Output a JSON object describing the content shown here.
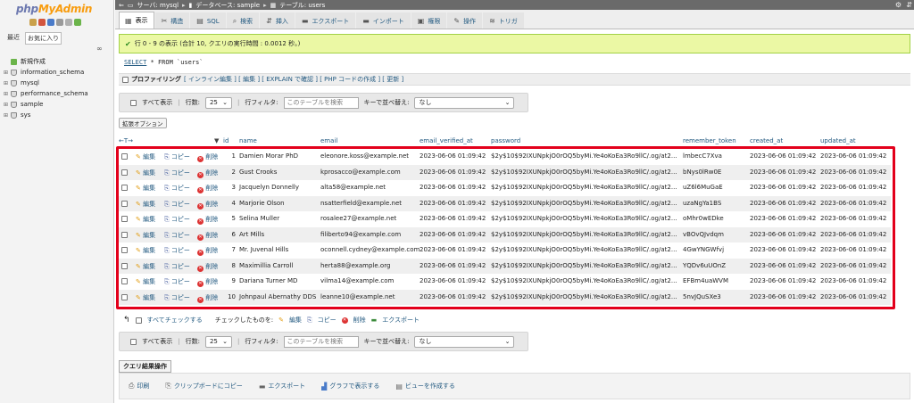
{
  "sidebar": {
    "logo_php": "php",
    "logo_myadmin": "MyAdmin",
    "tabs": [
      "最近",
      "お気に入り"
    ],
    "new_label": "新規作成",
    "databases": [
      "information_schema",
      "mysql",
      "performance_schema",
      "sample",
      "sys"
    ]
  },
  "breadcrumb": {
    "server": "サーバ: mysql",
    "database": "データベース: sample",
    "table": "テーブル: users"
  },
  "tabs": [
    {
      "label": "表示",
      "icon": "browse-icon",
      "glyph": "▦",
      "active": true
    },
    {
      "label": "構造",
      "icon": "structure-icon",
      "glyph": "✂",
      "active": false
    },
    {
      "label": "SQL",
      "icon": "sql-icon",
      "glyph": "▤",
      "active": false
    },
    {
      "label": "検索",
      "icon": "search-icon",
      "glyph": "⌕",
      "active": false
    },
    {
      "label": "挿入",
      "icon": "insert-icon",
      "glyph": "⇵",
      "active": false
    },
    {
      "label": "エクスポート",
      "icon": "export-icon",
      "glyph": "▬",
      "active": false
    },
    {
      "label": "インポート",
      "icon": "import-icon",
      "glyph": "▬",
      "active": false
    },
    {
      "label": "権限",
      "icon": "privileges-icon",
      "glyph": "▣",
      "active": false
    },
    {
      "label": "操作",
      "icon": "operations-icon",
      "glyph": "✎",
      "active": false
    },
    {
      "label": "トリガ",
      "icon": "triggers-icon",
      "glyph": "≋",
      "active": false
    }
  ],
  "message": "行 0 - 9 の表示 (合計 10, クエリの実行時間 : 0.0012 秒。)",
  "sql": {
    "keyword": "SELECT",
    "rest": " * FROM `users`"
  },
  "profiling": {
    "label": "プロファイリング",
    "links": "[ インライン編集 ] [ 編集 ] [ EXPLAIN で確認 ] [ PHP コードの作成 ] [ 更新 ]"
  },
  "nav": {
    "show_all": "すべて表示",
    "rows_label": "行数:",
    "rows_value": "25",
    "filter_label": "行フィルタ:",
    "filter_placeholder": "このテーブルを検索",
    "sort_label": "キーで並べ替え:",
    "sort_value": "なし"
  },
  "extra_options": "拡張オプション",
  "columns": [
    "id",
    "name",
    "email",
    "email_verified_at",
    "password",
    "remember_token",
    "created_at",
    "updated_at"
  ],
  "header_arrows": "←T→",
  "sort_arrow": "▼",
  "actions": {
    "edit": "編集",
    "copy": "コピー",
    "delete": "削除"
  },
  "rows": [
    {
      "id": "1",
      "name": "Damien Morar PhD",
      "email": "eleonore.koss@example.net",
      "verified": "2023-06-06 01:09:42",
      "password": "$2y$10$92IXUNpkjO0rOQ5byMi.Ye4oKoEa3Ro9llC/.og/at2...",
      "token": "lmbecC7Xva",
      "created": "2023-06-06 01:09:42",
      "updated": "2023-06-06 01:09:42"
    },
    {
      "id": "2",
      "name": "Gust Crooks",
      "email": "kprosacco@example.com",
      "verified": "2023-06-06 01:09:42",
      "password": "$2y$10$92IXUNpkjO0rOQ5byMi.Ye4oKoEa3Ro9llC/.og/at2...",
      "token": "bNys0lRw0E",
      "created": "2023-06-06 01:09:42",
      "updated": "2023-06-06 01:09:42"
    },
    {
      "id": "3",
      "name": "Jacquelyn Donnelly",
      "email": "alta58@example.net",
      "verified": "2023-06-06 01:09:42",
      "password": "$2y$10$92IXUNpkjO0rOQ5byMi.Ye4oKoEa3Ro9llC/.og/at2...",
      "token": "uZ6l6MuGaE",
      "created": "2023-06-06 01:09:42",
      "updated": "2023-06-06 01:09:42"
    },
    {
      "id": "4",
      "name": "Marjorie Olson",
      "email": "nsatterfield@example.net",
      "verified": "2023-06-06 01:09:42",
      "password": "$2y$10$92IXUNpkjO0rOQ5byMi.Ye4oKoEa3Ro9llC/.og/at2...",
      "token": "uzaNgYa1BS",
      "created": "2023-06-06 01:09:42",
      "updated": "2023-06-06 01:09:42"
    },
    {
      "id": "5",
      "name": "Selina Muller",
      "email": "rosalee27@example.net",
      "verified": "2023-06-06 01:09:42",
      "password": "$2y$10$92IXUNpkjO0rOQ5byMi.Ye4oKoEa3Ro9llC/.og/at2...",
      "token": "oMhr0wEDke",
      "created": "2023-06-06 01:09:42",
      "updated": "2023-06-06 01:09:42"
    },
    {
      "id": "6",
      "name": "Art Mills",
      "email": "filiberto94@example.com",
      "verified": "2023-06-06 01:09:42",
      "password": "$2y$10$92IXUNpkjO0rOQ5byMi.Ye4oKoEa3Ro9llC/.og/at2...",
      "token": "vBOvQJvdqm",
      "created": "2023-06-06 01:09:42",
      "updated": "2023-06-06 01:09:42"
    },
    {
      "id": "7",
      "name": "Mr. Juvenal Hills",
      "email": "oconnell.cydney@example.com",
      "verified": "2023-06-06 01:09:42",
      "password": "$2y$10$92IXUNpkjO0rOQ5byMi.Ye4oKoEa3Ro9llC/.og/at2...",
      "token": "4GwYNGWfvj",
      "created": "2023-06-06 01:09:42",
      "updated": "2023-06-06 01:09:42"
    },
    {
      "id": "8",
      "name": "Maximillia Carroll",
      "email": "herta88@example.org",
      "verified": "2023-06-06 01:09:42",
      "password": "$2y$10$92IXUNpkjO0rOQ5byMi.Ye4oKoEa3Ro9llC/.og/at2...",
      "token": "YQDv6uUOnZ",
      "created": "2023-06-06 01:09:42",
      "updated": "2023-06-06 01:09:42"
    },
    {
      "id": "9",
      "name": "Dariana Turner MD",
      "email": "vilma14@example.com",
      "verified": "2023-06-06 01:09:42",
      "password": "$2y$10$92IXUNpkjO0rOQ5byMi.Ye4oKoEa3Ro9llC/.og/at2...",
      "token": "EFBm4uaWVM",
      "created": "2023-06-06 01:09:42",
      "updated": "2023-06-06 01:09:42"
    },
    {
      "id": "10",
      "name": "Johnpaul Abernathy DDS",
      "email": "leanne10@example.net",
      "verified": "2023-06-06 01:09:42",
      "password": "$2y$10$92IXUNpkjO0rOQ5byMi.Ye4oKoEa3Ro9llC/.og/at2...",
      "token": "5nvJQuSXe3",
      "created": "2023-06-06 01:09:42",
      "updated": "2023-06-06 01:09:42"
    }
  ],
  "bulk": {
    "check_all": "すべてチェックする",
    "with_selected": "チェックしたものを:",
    "edit": "編集",
    "copy": "コピー",
    "delete": "削除",
    "export": "エクスポート"
  },
  "query_results": {
    "title": "クエリ結果操作",
    "print": "印刷",
    "copy_clipboard": "クリップボードにコピー",
    "export": "エクスポート",
    "chart": "グラフで表示する",
    "create_view": "ビューを作成する"
  },
  "colors": {
    "accent_link": "#235a81",
    "success_bg": "#ebf8a4",
    "highlight_border": "#e3001b"
  }
}
